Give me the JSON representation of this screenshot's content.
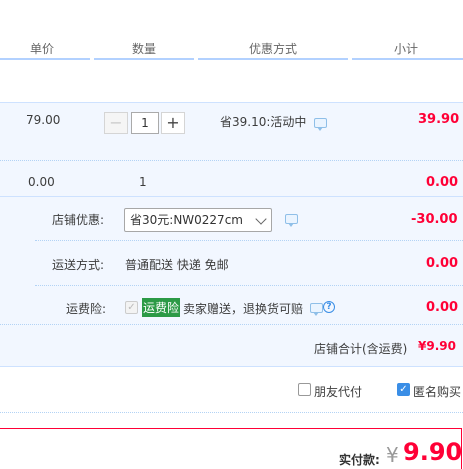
{
  "columns": {
    "unit_price": "单价",
    "quantity": "数量",
    "discount_method": "优惠方式",
    "subtotal": "小计"
  },
  "item": {
    "unit_price": "79.00",
    "quantity": "1",
    "minus": "−",
    "plus": "+",
    "discount": "省39.10:活动中",
    "subtotal": "39.90"
  },
  "second_row": {
    "unit_price": "0.00",
    "quantity": "1",
    "subtotal": "0.00"
  },
  "shop_discount": {
    "label": "店铺优惠:",
    "selected": "省30元:NW0227cm",
    "amount": "-30.00"
  },
  "shipping": {
    "label": "运送方式:",
    "value": "普通配送 快递 免邮",
    "amount": "0.00"
  },
  "insurance": {
    "label": "运费险:",
    "tag": "运费险",
    "description": "卖家赠送，退换货可赔",
    "help": "?",
    "amount": "0.00"
  },
  "shop_total": {
    "label": "店铺合计(含运费)",
    "amount": "¥9.90"
  },
  "options": {
    "friend_pay": "朋友代付",
    "anonymous": "匿名购买",
    "check": "✓"
  },
  "payment": {
    "label": "实付款:",
    "currency": "¥",
    "amount": "9.90"
  },
  "colors": {
    "accent": "#ff0036",
    "header_line": "#b2d1ff",
    "band": "#f2f7ff",
    "checkbox": "#3a8ee6",
    "tag": "#2c9a46"
  },
  "icons": [
    "minus-icon",
    "plus-icon",
    "message-bubble-icon",
    "chevron-down-icon",
    "help-icon",
    "checkbox-icon"
  ]
}
